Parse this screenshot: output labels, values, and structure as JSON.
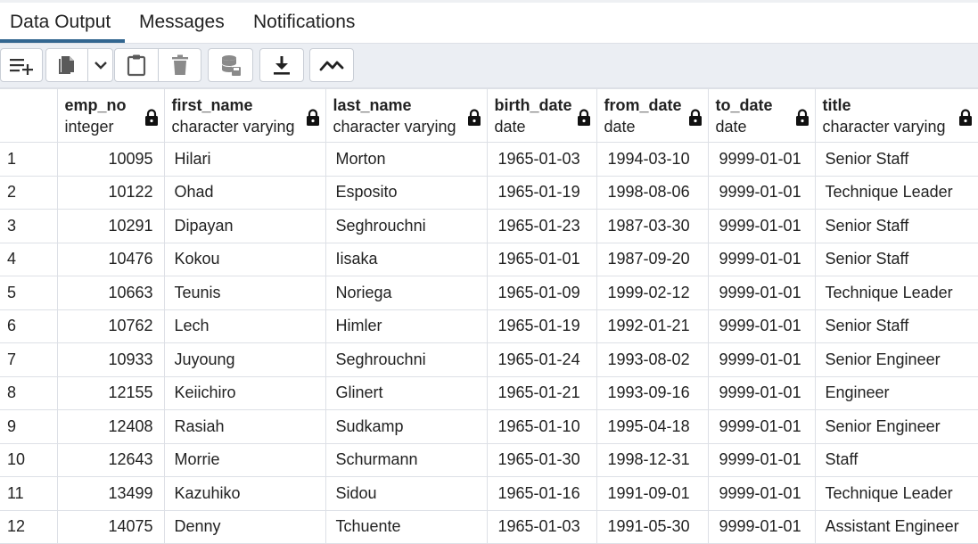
{
  "tabs": [
    {
      "label": "Data Output",
      "active": true
    },
    {
      "label": "Messages",
      "active": false
    },
    {
      "label": "Notifications",
      "active": false
    }
  ],
  "toolbar": {
    "buttons": [
      "add-row-icon",
      "copy-icon",
      "chevron-down-icon",
      "paste-icon",
      "delete-icon",
      "save-data-icon",
      "download-icon",
      "graph-visualiser-icon"
    ]
  },
  "columns": [
    {
      "name": "emp_no",
      "type": "integer"
    },
    {
      "name": "first_name",
      "type": "character varying"
    },
    {
      "name": "last_name",
      "type": "character varying"
    },
    {
      "name": "birth_date",
      "type": "date"
    },
    {
      "name": "from_date",
      "type": "date"
    },
    {
      "name": "to_date",
      "type": "date"
    },
    {
      "name": "title",
      "type": "character varying"
    }
  ],
  "rows": [
    [
      "1",
      "10095",
      "Hilari",
      "Morton",
      "1965-01-03",
      "1994-03-10",
      "9999-01-01",
      "Senior Staff"
    ],
    [
      "2",
      "10122",
      "Ohad",
      "Esposito",
      "1965-01-19",
      "1998-08-06",
      "9999-01-01",
      "Technique Leader"
    ],
    [
      "3",
      "10291",
      "Dipayan",
      "Seghrouchni",
      "1965-01-23",
      "1987-03-30",
      "9999-01-01",
      "Senior Staff"
    ],
    [
      "4",
      "10476",
      "Kokou",
      "Iisaka",
      "1965-01-01",
      "1987-09-20",
      "9999-01-01",
      "Senior Staff"
    ],
    [
      "5",
      "10663",
      "Teunis",
      "Noriega",
      "1965-01-09",
      "1999-02-12",
      "9999-01-01",
      "Technique Leader"
    ],
    [
      "6",
      "10762",
      "Lech",
      "Himler",
      "1965-01-19",
      "1992-01-21",
      "9999-01-01",
      "Senior Staff"
    ],
    [
      "7",
      "10933",
      "Juyoung",
      "Seghrouchni",
      "1965-01-24",
      "1993-08-02",
      "9999-01-01",
      "Senior Engineer"
    ],
    [
      "8",
      "12155",
      "Keiichiro",
      "Glinert",
      "1965-01-21",
      "1993-09-16",
      "9999-01-01",
      "Engineer"
    ],
    [
      "9",
      "12408",
      "Rasiah",
      "Sudkamp",
      "1965-01-10",
      "1995-04-18",
      "9999-01-01",
      "Senior Engineer"
    ],
    [
      "10",
      "12643",
      "Morrie",
      "Schurmann",
      "1965-01-30",
      "1998-12-31",
      "9999-01-01",
      "Staff"
    ],
    [
      "11",
      "13499",
      "Kazuhiko",
      "Sidou",
      "1965-01-16",
      "1991-09-01",
      "9999-01-01",
      "Technique Leader"
    ],
    [
      "12",
      "14075",
      "Denny",
      "Tchuente",
      "1965-01-03",
      "1991-05-30",
      "9999-01-01",
      "Assistant Engineer"
    ]
  ]
}
